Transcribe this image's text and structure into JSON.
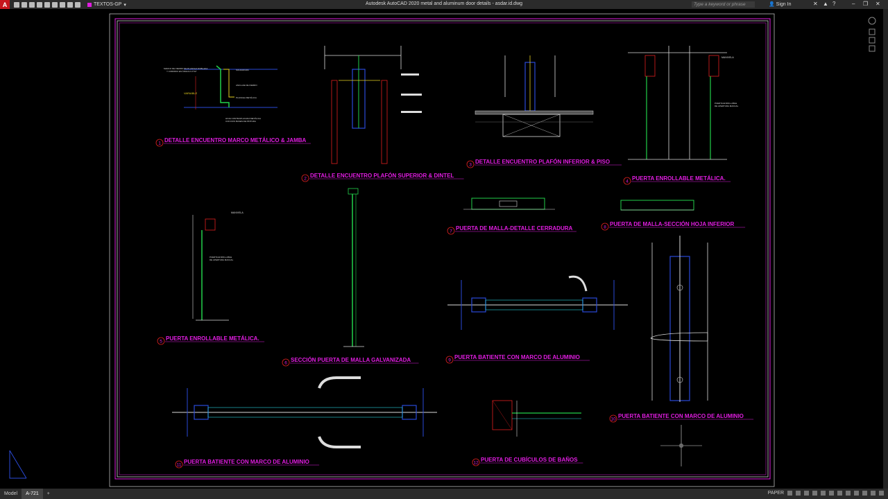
{
  "app": {
    "logo": "A",
    "layer_name": "TEXTOS-GP",
    "title": "Autodesk AutoCAD 2020   metal and aluminum door details - asdar.id.dwg",
    "search_placeholder": "Type a keyword or phrase",
    "sign_in": "Sign In",
    "help": "?"
  },
  "colors": {
    "magenta": "#e11de1",
    "frame": "#cfcfcf",
    "green": "#22d14a",
    "cyan": "#2ad6e0",
    "blue": "#2a4ad8",
    "red": "#e02020",
    "yellow": "#e6d020",
    "white": "#e8e8e8"
  },
  "details": [
    {
      "num": "1",
      "title": "DETALLE ENCUENTRO MARCO METÁLICO & JAMBA"
    },
    {
      "num": "2",
      "title": "DETALLE ENCUENTRO PLAFÓN SUPERIOR & DINTEL"
    },
    {
      "num": "3",
      "title": "DETALLE ENCUENTRO PLAFÓN INFERIOR & PISO"
    },
    {
      "num": "4",
      "title": "PUERTA ENROLLABLE METÁLICA."
    },
    {
      "num": "5",
      "title": "PUERTA ENROLLABLE METÁLICA."
    },
    {
      "num": "6",
      "title": "SECCIÓN PUERTA DE MALLA GALVANIZADA"
    },
    {
      "num": "7",
      "title": "PUERTA DE MALLA-DETALLE CERRADURA"
    },
    {
      "num": "8",
      "title": "PUERTA DE MALLA-SECCIÓN HOJA INFERIOR"
    },
    {
      "num": "9",
      "title": "PUERTA BATIENTE CON MARCO DE ALUMINIO"
    },
    {
      "num": "10",
      "title": "PUERTA BATIENTE CON MARCO DE ALUMINIO"
    },
    {
      "num": "11",
      "title": "PUERTA BATIENTE CON MARCO DE ALUMINIO"
    },
    {
      "num": "12",
      "title": "PUERTA DE CUBÍCULOS DE BAÑOS"
    }
  ],
  "annotations": {
    "manivela": "MANIVELA",
    "variable": "VARIABLE"
  },
  "status": {
    "tab_model": "Model",
    "tab_layout": "A-721",
    "add_tab": "+",
    "paper": "PAPER"
  }
}
